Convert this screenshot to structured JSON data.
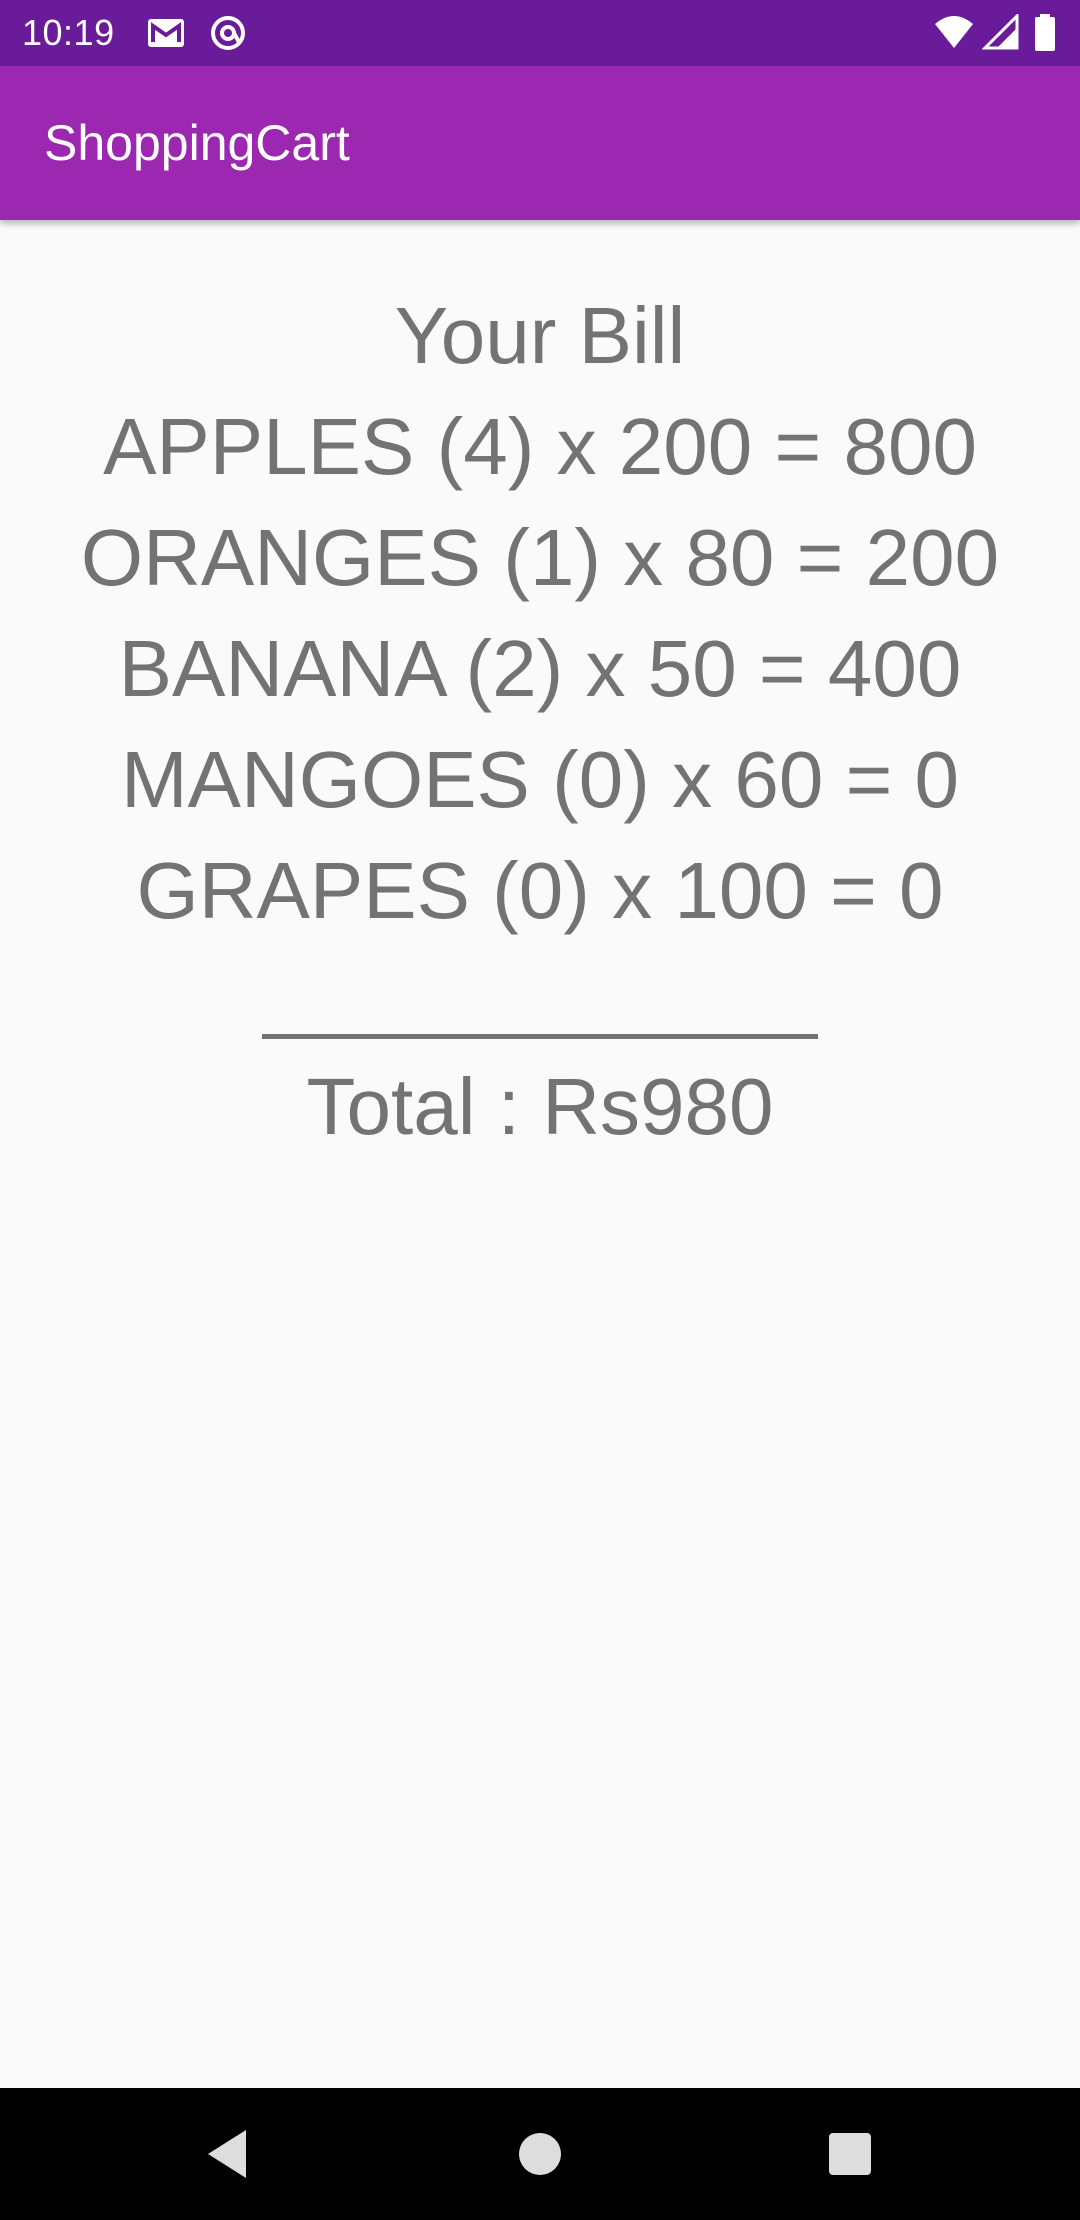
{
  "status_bar": {
    "time": "10:19",
    "icons": [
      "gmail-icon",
      "at-sign-icon",
      "wifi-icon",
      "signal-icon",
      "battery-icon"
    ]
  },
  "app_bar": {
    "title": "ShoppingCart"
  },
  "bill": {
    "heading": "Your Bill",
    "items": [
      "APPLES (4) x 200 = 800",
      "ORANGES (1) x 80 = 200",
      "BANANA (2) x 50 = 400",
      "MANGOES (0) x 60 = 0",
      "GRAPES (0) x 100 = 0"
    ],
    "total": "Total : Rs980"
  },
  "nav_bar": {
    "buttons": [
      "back-icon",
      "home-icon",
      "recents-icon"
    ]
  },
  "colors": {
    "status_bar": "#6a1b9a",
    "app_bar": "#9c27b0",
    "text": "#737373",
    "background": "#fafafa"
  }
}
